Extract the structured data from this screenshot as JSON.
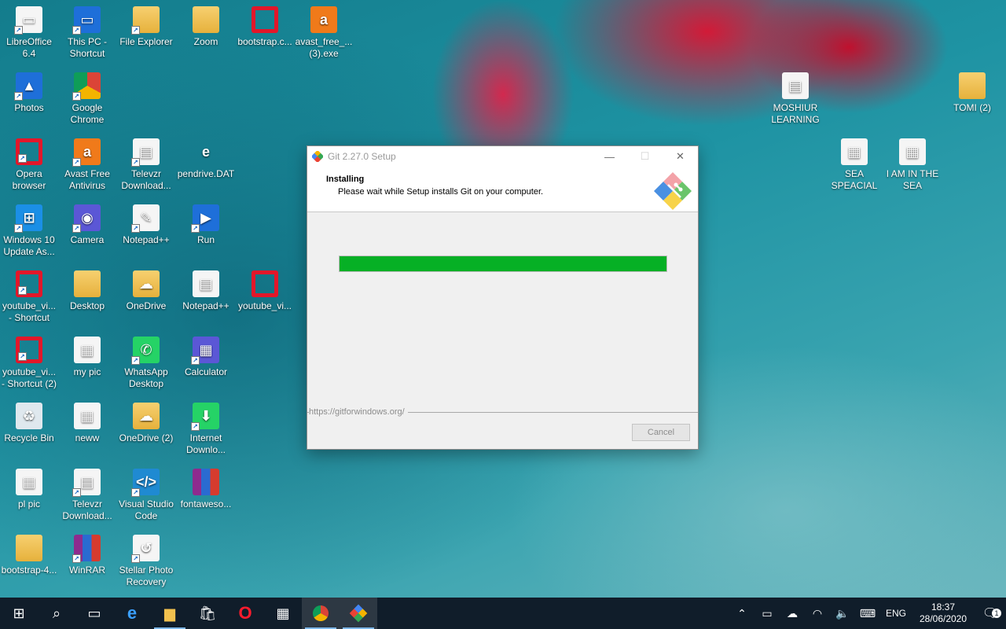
{
  "desktop": {
    "icons": [
      {
        "label": "LibreOffice 6.4",
        "icon": "libreoffice-icon"
      },
      {
        "label": "This PC - Shortcut",
        "icon": "computer-icon"
      },
      {
        "label": "File Explorer",
        "icon": "folder-icon"
      },
      {
        "label": "Zoom",
        "icon": "folder-icon"
      },
      {
        "label": "bootstrap.c...",
        "icon": "opera-icon"
      },
      {
        "label": "avast_free_... (3).exe",
        "icon": "avast-icon"
      },
      {
        "label": "Photos",
        "icon": "photos-icon"
      },
      {
        "label": "Google Chrome",
        "icon": "chrome-icon"
      },
      {
        "label": "Opera browser",
        "icon": "opera-icon"
      },
      {
        "label": "Avast Free Antivirus",
        "icon": "avast-icon"
      },
      {
        "label": "Televzr Download...",
        "icon": "document-icon"
      },
      {
        "label": "pendrive.DAT",
        "icon": "internet-explorer-icon"
      },
      {
        "label": "Windows 10 Update As...",
        "icon": "windows-icon"
      },
      {
        "label": "Camera",
        "icon": "camera-icon"
      },
      {
        "label": "Notepad++",
        "icon": "notepad-icon"
      },
      {
        "label": "Run",
        "icon": "run-icon"
      },
      {
        "label": "youtube_vi... - Shortcut",
        "icon": "opera-icon"
      },
      {
        "label": "Desktop",
        "icon": "folder-icon"
      },
      {
        "label": "OneDrive",
        "icon": "onedrive-folder-icon"
      },
      {
        "label": "Notepad++",
        "icon": "document-icon"
      },
      {
        "label": "youtube_vi...",
        "icon": "opera-icon"
      },
      {
        "label": "youtube_vi... - Shortcut (2)",
        "icon": "opera-icon"
      },
      {
        "label": "my pic",
        "icon": "image-file-icon"
      },
      {
        "label": "WhatsApp Desktop",
        "icon": "whatsapp-icon"
      },
      {
        "label": "Calculator",
        "icon": "calculator-icon"
      },
      {
        "label": "Recycle Bin",
        "icon": "recycle-bin-icon"
      },
      {
        "label": "neww",
        "icon": "image-file-icon"
      },
      {
        "label": "OneDrive (2)",
        "icon": "onedrive-folder-icon"
      },
      {
        "label": "Internet Downlo...",
        "icon": "idm-icon"
      },
      {
        "label": "pl pic",
        "icon": "image-file-icon"
      },
      {
        "label": "Televzr Download...",
        "icon": "document-icon"
      },
      {
        "label": "Visual Studio Code",
        "icon": "vscode-icon"
      },
      {
        "label": "fontaweso...",
        "icon": "winrar-icon"
      },
      {
        "label": "bootstrap-4...",
        "icon": "folder-icon"
      },
      {
        "label": "WinRAR",
        "icon": "winrar-icon"
      },
      {
        "label": "Stellar Photo Recovery",
        "icon": "stellar-icon"
      },
      {
        "label": "MOSHIUR LEARNING",
        "icon": "document-icon"
      },
      {
        "label": "TOMI (2)",
        "icon": "folder-icon"
      },
      {
        "label": "SEA SPEACIAL",
        "icon": "image-file-icon"
      },
      {
        "label": "I AM IN THE SEA",
        "icon": "image-file-icon"
      }
    ]
  },
  "dialog": {
    "title": "Git 2.27.0 Setup",
    "heading": "Installing",
    "subheading": "Please wait while Setup installs Git on your computer.",
    "progress": 1.0,
    "progress_color": "#06b025",
    "footer_url": "https://gitforwindows.org/",
    "cancel_label": "Cancel",
    "minimize": "—",
    "maximize": "☐",
    "close": "✕"
  },
  "taskbar": {
    "items": [
      {
        "icon": "start-windows-icon"
      },
      {
        "icon": "search-icon"
      },
      {
        "icon": "task-view-icon"
      },
      {
        "icon": "edge-icon"
      },
      {
        "icon": "file-explorer-icon"
      },
      {
        "icon": "store-icon"
      },
      {
        "icon": "opera-icon"
      },
      {
        "icon": "calculator-icon"
      },
      {
        "icon": "chrome-icon"
      },
      {
        "icon": "git-icon"
      }
    ],
    "language": "ENG",
    "time": "18:37",
    "date": "28/06/2020",
    "notification_count": "1"
  }
}
